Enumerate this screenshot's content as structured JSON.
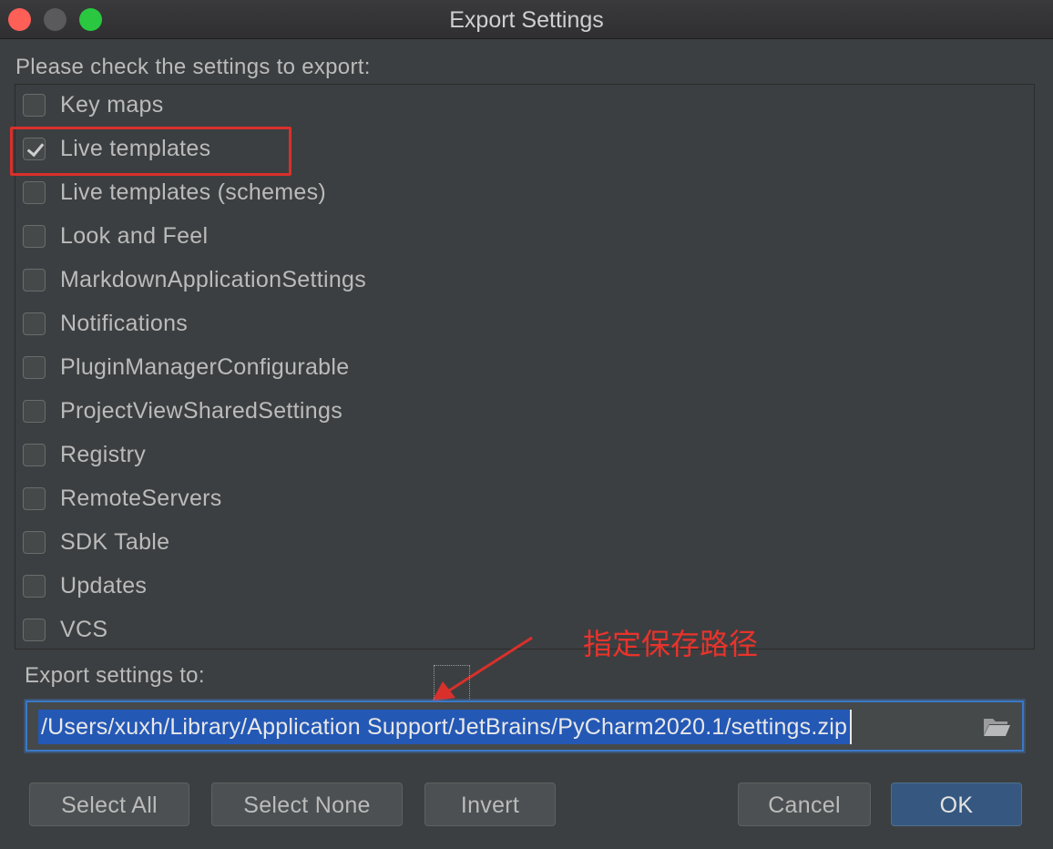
{
  "window": {
    "title": "Export Settings"
  },
  "prompt": "Please check the settings to export:",
  "settings": [
    {
      "label": "Key maps",
      "checked": false
    },
    {
      "label": "Live templates",
      "checked": true
    },
    {
      "label": "Live templates (schemes)",
      "checked": false
    },
    {
      "label": "Look and Feel",
      "checked": false
    },
    {
      "label": "MarkdownApplicationSettings",
      "checked": false
    },
    {
      "label": "Notifications",
      "checked": false
    },
    {
      "label": "PluginManagerConfigurable",
      "checked": false
    },
    {
      "label": "ProjectViewSharedSettings",
      "checked": false
    },
    {
      "label": "Registry",
      "checked": false
    },
    {
      "label": "RemoteServers",
      "checked": false
    },
    {
      "label": "SDK Table",
      "checked": false
    },
    {
      "label": "Updates",
      "checked": false
    },
    {
      "label": "VCS",
      "checked": false
    }
  ],
  "export": {
    "label": "Export settings to:",
    "path": "/Users/xuxh/Library/Application Support/JetBrains/PyCharm2020.1/settings.zip",
    "browse_icon": "folder-icon"
  },
  "annotation": {
    "text": "指定保存路径",
    "color": "#e8332c"
  },
  "buttons": {
    "select_all": "Select All",
    "select_none": "Select None",
    "invert": "Invert",
    "cancel": "Cancel",
    "ok": "OK"
  },
  "colors": {
    "background": "#3c3f41",
    "accent": "#3b78c6",
    "selection": "#2458b5",
    "ok_button": "#365880",
    "annotation": "#d9302b"
  }
}
